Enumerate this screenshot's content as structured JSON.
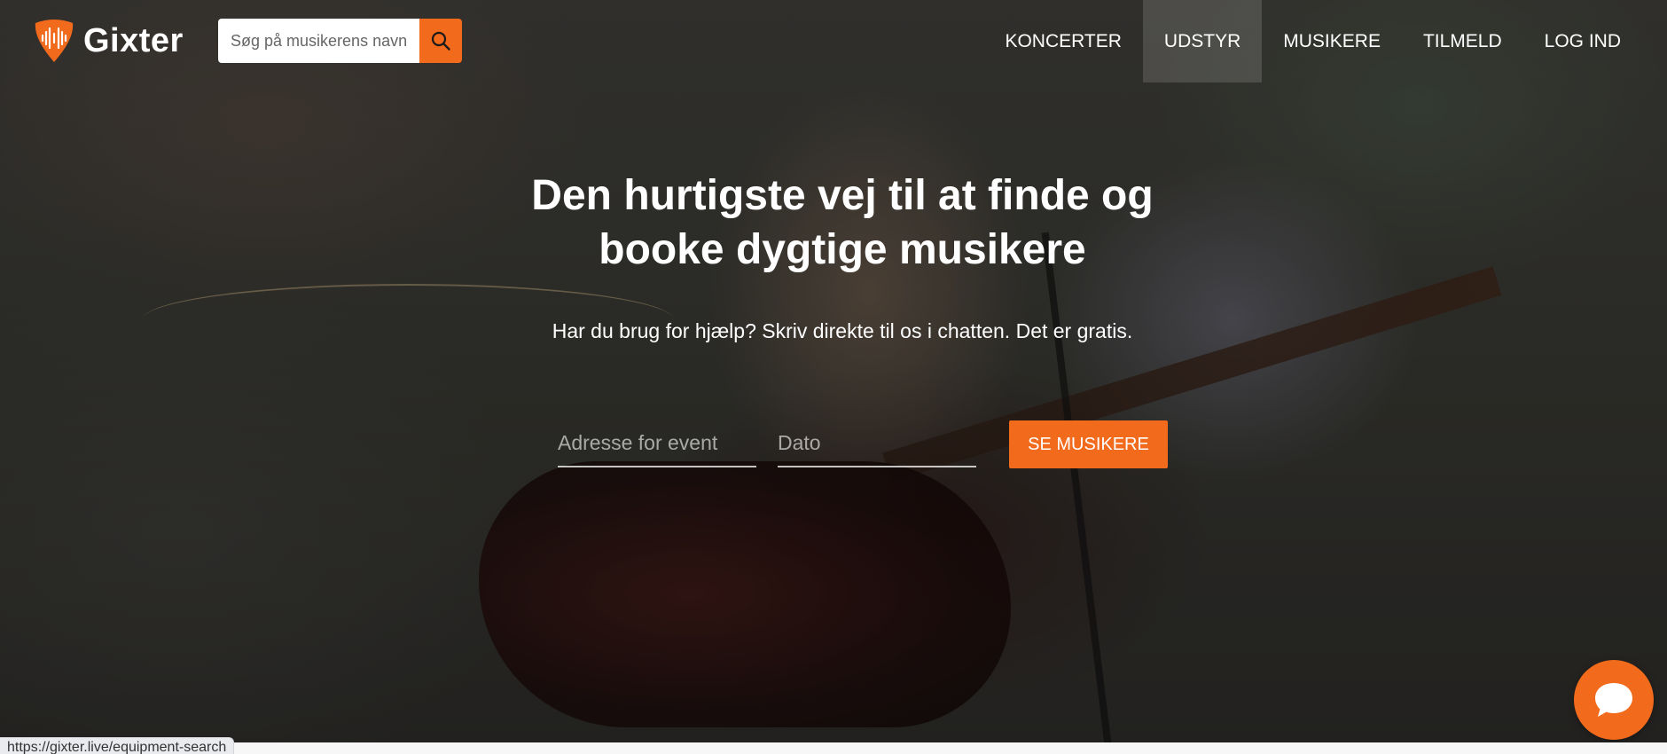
{
  "brand": {
    "name": "Gixter",
    "accent_color": "#f26a1b",
    "logo_icon": "pick-soundwave-icon"
  },
  "search": {
    "placeholder": "Søg på musikerens navn",
    "button_icon": "search-icon"
  },
  "nav": {
    "items": [
      {
        "label": "KONCERTER",
        "active": false
      },
      {
        "label": "UDSTYR",
        "active": true
      },
      {
        "label": "MUSIKERE",
        "active": false
      },
      {
        "label": "TILMELD",
        "active": false
      },
      {
        "label": "LOG IND",
        "active": false
      }
    ]
  },
  "hero": {
    "headline_line1": "Den hurtigste vej til at finde og",
    "headline_line2": "booke dygtige musikere",
    "subline": "Har du brug for hjælp? Skriv direkte til os i chatten. Det er gratis."
  },
  "booking_form": {
    "address_placeholder": "Adresse for event",
    "date_placeholder": "Dato",
    "submit_label": "SE MUSIKERE"
  },
  "chat": {
    "icon": "chat-bubble-icon"
  },
  "status_bar": {
    "url": "https://gixter.live/equipment-search"
  }
}
